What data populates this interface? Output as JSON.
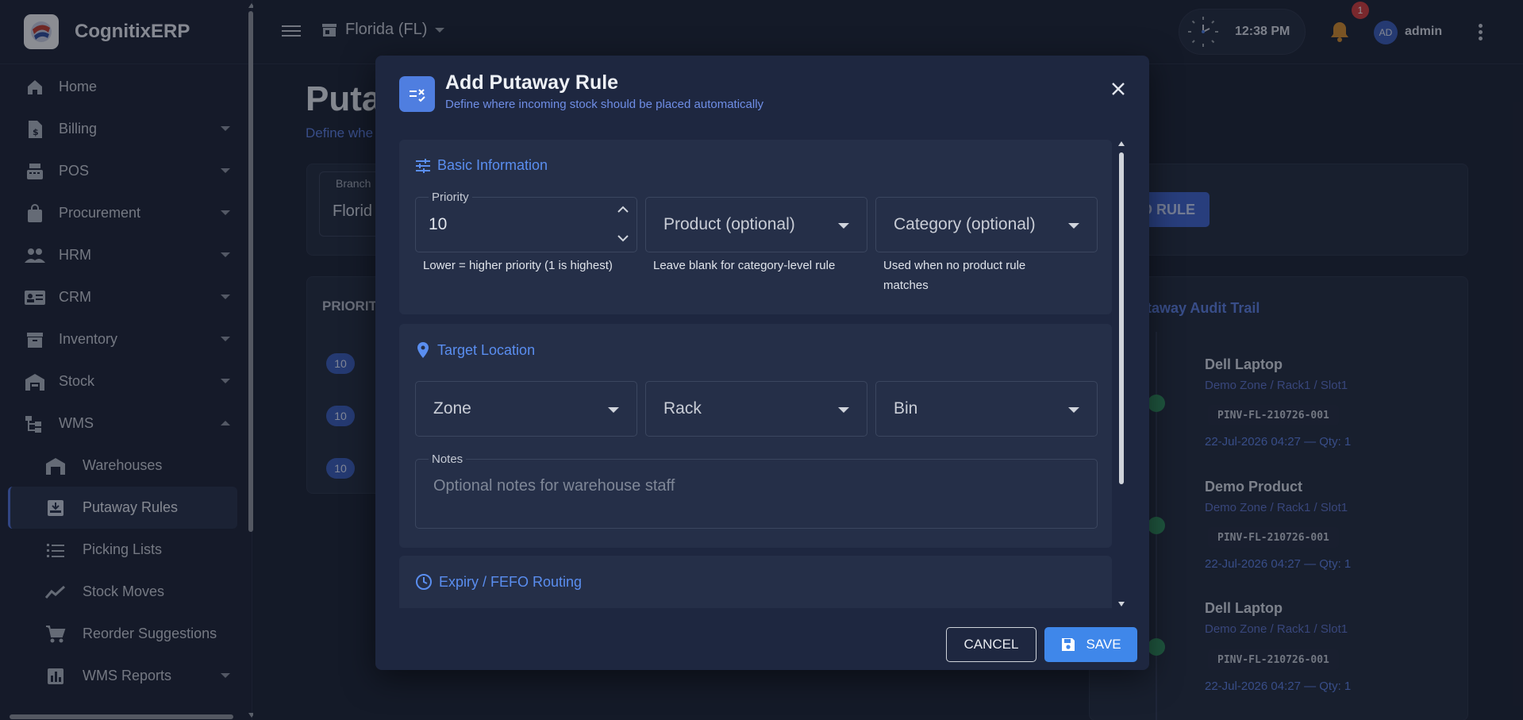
{
  "app": {
    "name": "CognitixERP"
  },
  "sidebar": {
    "items": [
      {
        "label": "Home",
        "icon": "home-icon"
      },
      {
        "label": "Billing",
        "icon": "billing-icon"
      },
      {
        "label": "POS",
        "icon": "pos-icon"
      },
      {
        "label": "Procurement",
        "icon": "bag-icon"
      },
      {
        "label": "HRM",
        "icon": "people-icon"
      },
      {
        "label": "CRM",
        "icon": "contact-card-icon"
      },
      {
        "label": "Inventory",
        "icon": "archive-icon"
      },
      {
        "label": "Stock",
        "icon": "warehouse-icon"
      },
      {
        "label": "WMS",
        "icon": "hierarchy-icon",
        "expanded": true
      }
    ],
    "wms_sub": [
      {
        "label": "Warehouses",
        "icon": "warehouse-icon"
      },
      {
        "label": "Putaway Rules",
        "icon": "inbox-arrow-icon",
        "active": true
      },
      {
        "label": "Picking Lists",
        "icon": "list-icon"
      },
      {
        "label": "Stock Moves",
        "icon": "trend-icon"
      },
      {
        "label": "Reorder Suggestions",
        "icon": "cart-icon"
      },
      {
        "label": "WMS Reports",
        "icon": "bar-chart-icon"
      }
    ]
  },
  "topbar": {
    "branch": "Florida (FL)",
    "time": "12:38 PM",
    "notifications": "1",
    "avatar": "AD",
    "user": "admin"
  },
  "background": {
    "page_title": "Puta",
    "page_sub": "Define whe",
    "branch_caption": "Branch",
    "branch_value": "Florid",
    "add_rule": "D RULE",
    "col_priority": "PRIORIT",
    "rows_priority": [
      "10",
      "10",
      "10"
    ],
    "audit_title": "utaway Audit Trail",
    "audit": [
      {
        "name": "Dell Laptop",
        "location": "Demo Zone / Rack1 / Slot1",
        "code": "PINV-FL-210726-001",
        "date": "22-Jul-2026 04:27 — Qty: 1"
      },
      {
        "name": "Demo Product",
        "location": "Demo Zone / Rack1 / Slot1",
        "code": "PINV-FL-210726-001",
        "date": "22-Jul-2026 04:27 — Qty: 1"
      },
      {
        "name": "Dell Laptop",
        "location": "Demo Zone / Rack1 / Slot1",
        "code": "PINV-FL-210726-001",
        "date": "22-Jul-2026 04:27 — Qty: 1"
      }
    ]
  },
  "modal": {
    "title": "Add Putaway Rule",
    "subtitle": "Define where incoming stock should be placed automatically",
    "basic": {
      "title": "Basic Information",
      "priority_label": "Priority",
      "priority_value": "10",
      "priority_help": "Lower = higher priority (1 is highest)",
      "product_placeholder": "Product (optional)",
      "product_help": "Leave blank for category-level rule",
      "category_placeholder": "Category (optional)",
      "category_help": "Used when no product rule matches"
    },
    "target": {
      "title": "Target Location",
      "zone": "Zone",
      "rack": "Rack",
      "bin": "Bin",
      "notes_label": "Notes",
      "notes_placeholder": "Optional notes for warehouse staff"
    },
    "expiry": {
      "title": "Expiry / FEFO Routing"
    },
    "cancel": "CANCEL",
    "save": "SAVE"
  },
  "colors": {
    "accent": "#3f87ea",
    "link": "#5a8ef0",
    "danger": "#d23b3b",
    "success": "#2f8f5c"
  }
}
